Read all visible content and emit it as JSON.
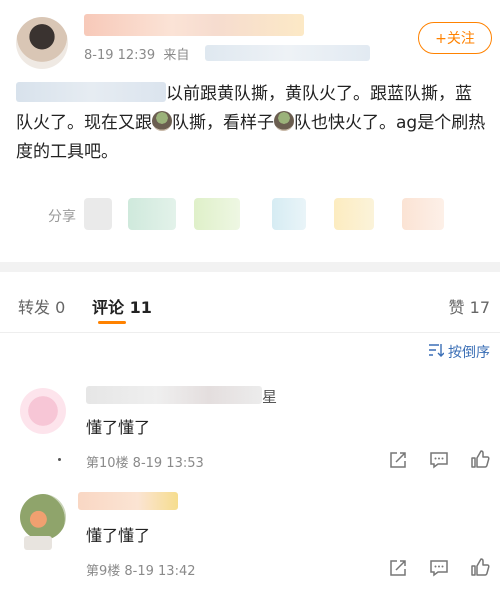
{
  "post": {
    "timestamp": "8-19 12:39",
    "source_prefix": "来自",
    "follow_label": "+关注",
    "text_part1": "以前跟黄队撕，黄队火了。跟蓝队撕，蓝队火了。现在又跟",
    "text_part2": "队撕，看样子",
    "text_part3": "队也快火了。ag是个刷热度的工具吧。",
    "share_label": "分享"
  },
  "tabs": [
    {
      "label": "转发 0"
    },
    {
      "label": "评论 11"
    },
    {
      "label": "赞 17"
    }
  ],
  "sort_label": "按倒序",
  "comments": [
    {
      "name_tail": "星",
      "text": "懂了懂了",
      "meta": "第10楼 8-19 13:53"
    },
    {
      "name_tail": "",
      "text": "懂了懂了",
      "meta": "第9楼 8-19 13:42"
    }
  ],
  "colors": {
    "accent": "#ff8200",
    "link": "#3b6fb6"
  }
}
